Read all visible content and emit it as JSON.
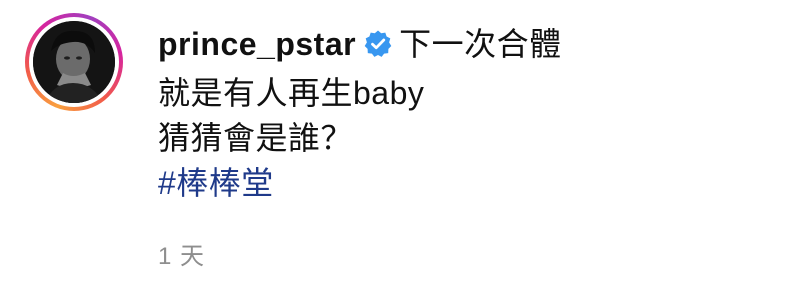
{
  "comment": {
    "username": "prince_pstar",
    "verified_icon": "verified-badge-icon",
    "lines": [
      "下一次合體",
      "就是有人再生baby",
      "猜猜會是誰？"
    ],
    "hashtag": "#棒棒堂",
    "timestamp": "1 天"
  },
  "colors": {
    "verified": "#3897f0",
    "hashtag": "#1f3a8a",
    "meta": "#8e8e8e"
  }
}
